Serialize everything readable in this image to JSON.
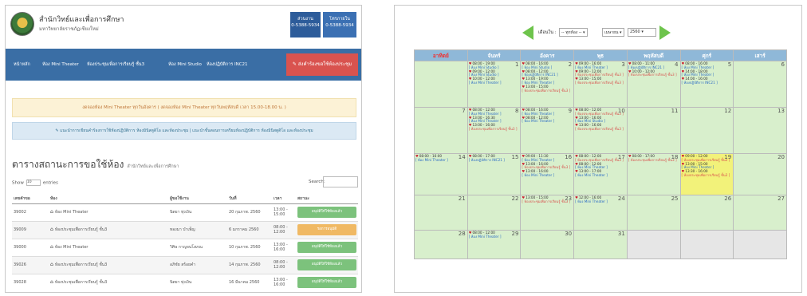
{
  "left": {
    "org_title": "สำนักวิทย์และเพื่อการศึกษา",
    "org_sub": "มหาวิทยาลัยราชภัฏเชียงใหม่",
    "contacts": [
      {
        "label": "ส่วนงาน",
        "phone": "0-5388-5934"
      },
      {
        "label": "โทรภายใน",
        "phone": "0-5388-5934"
      }
    ],
    "nav": [
      "หน้าหลัก",
      "ห้อง Mini Theater",
      "ห้องประชุมเพื่อการเรียนรู้ ชั้น3",
      "ห้อง Mini Studio",
      "ห้องปฏิบัติการ INC21"
    ],
    "book_button": "ส่งคำร้องขอใช้ห้องประชุม",
    "notice_yellow": "งดจองห้อง Mini Theater ทุกวันอังคาร ( งดจองห้อง Mini Theater ทุกวันพฤหัสบดี เวลา 15.00-18.00 น. )",
    "notice_blue": "แนะนำการเขียนคำร้องการใช้ห้องปฏิบัติการ ห้องมินิสตูดิโอ และห้องประชุม | แนะนำขั้นตอนการเตรียมห้องปฏิบัติการ ห้องมินิสตูดิโอ และห้องประชุม",
    "table_title": "ตารางสถานะการขอใช้ห้อง",
    "table_sub": "สำนักวิทย์และเพื่อการศึกษา",
    "show_label": "Show",
    "show_value": "10",
    "entries_label": "entries",
    "search_label": "Search:",
    "headers": [
      "เลขคำขอ",
      "ห้อง",
      "ผู้ขอใช้งาน",
      "วันที่",
      "เวลา",
      "สถานะ"
    ],
    "rows": [
      {
        "id": "39002",
        "room": "ห้อง Mini Theater",
        "user": "นิตยา ทุ่งเงิน",
        "date": "20 กุมภาพ. 2560",
        "time": "13:00 - 15:00",
        "status": "อนุมัติให้ใช้ห้องแล้ว",
        "kind": "green"
      },
      {
        "id": "39009",
        "room": "ห้องประชุมเพื่อการเรียนรู้ ชั้น3",
        "user": "ทองมา บำเพ็ญ",
        "date": "6 มกราคม 2560",
        "time": "08:00 - 12:00",
        "status": "รอการอนุมัติ",
        "kind": "orange"
      },
      {
        "id": "39000",
        "room": "ห้อง Mini Theater",
        "user": "วิศิษ กาญจนโสภณ",
        "date": "10 กุมภาพ. 2560",
        "time": "13:00 - 16:00",
        "status": "อนุมัติให้ใช้ห้องแล้ว",
        "kind": "green"
      },
      {
        "id": "39026",
        "room": "ห้องประชุมเพื่อการเรียนรู้ ชั้น3",
        "user": "อภิชัย สร้อยคำ",
        "date": "14 กุมภาพ. 2560",
        "time": "08:00 - 12:00",
        "status": "อนุมัติให้ใช้ห้องแล้ว",
        "kind": "green"
      },
      {
        "id": "39028",
        "room": "ห้องประชุมเพื่อการเรียนรู้ ชั้น3",
        "user": "นิตยา ทุ่งเงิน",
        "date": "16 มีนาคม 2560",
        "time": "13:00 - 16:00",
        "status": "อนุมัติให้ใช้ห้องแล้ว",
        "kind": "green"
      }
    ]
  },
  "right": {
    "month_label": "เดือนใน :",
    "room_select": "-- ทุกห้อง --",
    "month_select": "เมษายน",
    "year_select": "2560",
    "weekdays": [
      "อาทิตย์",
      "จันทร์",
      "อังคาร",
      "พุธ",
      "พฤหัสบดี",
      "ศุกร์",
      "เสาร์"
    ],
    "weeks": [
      [
        {
          "day": "",
          "kind": "sun"
        },
        {
          "day": "1",
          "events": [
            [
              "08:00 - 19:00",
              "b",
              "[ ห้อง Mini Studio ]"
            ],
            [
              "09:00 - 12:00",
              "b",
              "[ ห้อง Mini Studio ]"
            ],
            [
              "10:00 - 12:00",
              "b",
              "[ ห้อง Mini Theater ]"
            ]
          ]
        },
        {
          "day": "2",
          "events": [
            [
              "08:00 - 16:00",
              "b",
              "[ ห้อง Mini Studio ]"
            ],
            [
              "08:00 - 12:00",
              "b",
              "[ ห้องปฏิบัติการ INC21 ]"
            ],
            [
              "13:00 - 19:00",
              "b",
              "[ ห้อง Mini Theater ]"
            ],
            [
              "13:00 - 15:00",
              "r",
              "[ ห้องประชุมเพื่อการเรียนรู้ ชั้น3 ]"
            ]
          ]
        },
        {
          "day": "3",
          "events": [
            [
              "09:00 - 16:00",
              "b",
              "[ ห้อง Mini Theater ]"
            ],
            [
              "09:00 - 12:00",
              "r",
              "[ ห้องประชุมเพื่อการเรียนรู้ ชั้น3 ]"
            ],
            [
              "13:00 - 15:00",
              "r",
              "[ ห้องประชุมเพื่อการเรียนรู้ ชั้น3 ]"
            ]
          ]
        },
        {
          "day": "4",
          "events": [
            [
              "08:00 - 11:00",
              "b",
              "[ ห้องปฏิบัติการ INC21 ]"
            ],
            [
              "10:00 - 12:00",
              "r",
              "[ ห้องประชุมเพื่อการเรียนรู้ ชั้น3 ]"
            ]
          ]
        },
        {
          "day": "5",
          "events": [
            [
              "08:00 - 16:00",
              "b",
              "[ ห้อง Mini Theater ]"
            ],
            [
              "14:00 - 18:00",
              "b",
              "[ ห้อง Mini Theater ]"
            ],
            [
              "14:00 - 16:00",
              "b",
              "[ ห้องปฏิบัติการ INC21 ]"
            ]
          ]
        },
        {
          "day": "6",
          "kind": "sat"
        }
      ],
      [
        {
          "day": "7",
          "kind": "sun"
        },
        {
          "day": "8",
          "events": [
            [
              "08:00 - 12:00",
              "b",
              "[ ห้อง Mini Theater ]"
            ],
            [
              "13:00 - 16:30",
              "b",
              "[ ห้อง Mini Theater ]"
            ],
            [
              "13:00 - 16:00",
              "r",
              "[ ห้องประชุมเพื่อการเรียนรู้ ชั้น3 ]"
            ]
          ]
        },
        {
          "day": "9",
          "events": [
            [
              "08:00 - 16:00",
              "b",
              "[ ห้อง Mini Theater ]"
            ],
            [
              "08:00 - 12:00",
              "b",
              "[ ห้อง Mini Theater ]"
            ]
          ]
        },
        {
          "day": "10",
          "events": [
            [
              "08:00 - 12:00",
              "r",
              "[ ห้องประชุมเพื่อการเรียนรู้ ชั้น3 ]"
            ],
            [
              "13:00 - 16:00",
              "b",
              "[ ห้อง Mini Studio ]"
            ],
            [
              "13:00 - 16:00",
              "r",
              "[ ห้องประชุมเพื่อการเรียนรู้ ชั้น3 ]"
            ]
          ]
        },
        {
          "day": "11"
        },
        {
          "day": "12"
        },
        {
          "day": "13",
          "kind": "sat"
        }
      ],
      [
        {
          "day": "14",
          "kind": "sun",
          "events": [
            [
              "08:00 - 16:00",
              "b",
              "[ ห้อง Mini Theater ]"
            ]
          ]
        },
        {
          "day": "15",
          "events": [
            [
              "08:00 - 17:00",
              "b",
              "[ ห้องปฏิบัติการ INC21 ]"
            ]
          ]
        },
        {
          "day": "16",
          "events": [
            [
              "09:00 - 11:30",
              "b",
              "[ ห้อง Mini Theater ]"
            ],
            [
              "13:00 - 16:00",
              "r",
              "[ ห้องประชุมเพื่อการเรียนรู้ ชั้น3 ]"
            ],
            [
              "13:00 - 16:00",
              "b",
              "[ ห้อง Mini Theater ]"
            ]
          ]
        },
        {
          "day": "17",
          "events": [
            [
              "08:00 - 12:00",
              "r",
              "[ ห้องประชุมเพื่อการเรียนรู้ ชั้น3 ]"
            ],
            [
              "08:00 - 12:00",
              "b",
              "[ ห้อง Mini Theater ]"
            ],
            [
              "13:00 - 17:00",
              "b",
              "[ ห้อง Mini Theater ]"
            ]
          ]
        },
        {
          "day": "18",
          "events": [
            [
              "08:00 - 17:00",
              "r",
              "[ ห้องประชุมเพื่อการเรียนรู้ ชั้น3 ]"
            ]
          ]
        },
        {
          "day": "19",
          "kind": "today",
          "events": [
            [
              "09:00 - 12:00",
              "r",
              "[ ห้องประชุมเพื่อการเรียนรู้ ชั้น3 ]"
            ],
            [
              "13:00 - 15:00",
              "b",
              "[ ห้อง Mini Theater ]"
            ],
            [
              "13:30 - 16:00",
              "r",
              "[ ห้องประชุมเพื่อการเรียนรู้ ชั้น3 ]"
            ]
          ]
        },
        {
          "day": "20",
          "kind": "sat"
        }
      ],
      [
        {
          "day": "21",
          "kind": "sun"
        },
        {
          "day": "22"
        },
        {
          "day": "23",
          "events": [
            [
              "13:00 - 15:00",
              "r",
              "[ ห้องประชุมเพื่อการเรียนรู้ ชั้น3 ]"
            ]
          ]
        },
        {
          "day": "24",
          "events": [
            [
              "12:00 - 16:00",
              "b",
              "[ ห้อง Mini Theater ]"
            ]
          ]
        },
        {
          "day": "25"
        },
        {
          "day": "26"
        },
        {
          "day": "27",
          "kind": "sat"
        }
      ],
      [
        {
          "day": "28",
          "kind": "sun"
        },
        {
          "day": "29",
          "events": [
            [
              "08:00 - 12:00",
              "b",
              "[ ห้อง Mini Theater ]"
            ]
          ]
        },
        {
          "day": "30"
        },
        {
          "day": "31"
        },
        {
          "day": "",
          "kind": "empty"
        },
        {
          "day": "",
          "kind": "empty"
        },
        {
          "day": "",
          "kind": "empty"
        }
      ]
    ]
  }
}
